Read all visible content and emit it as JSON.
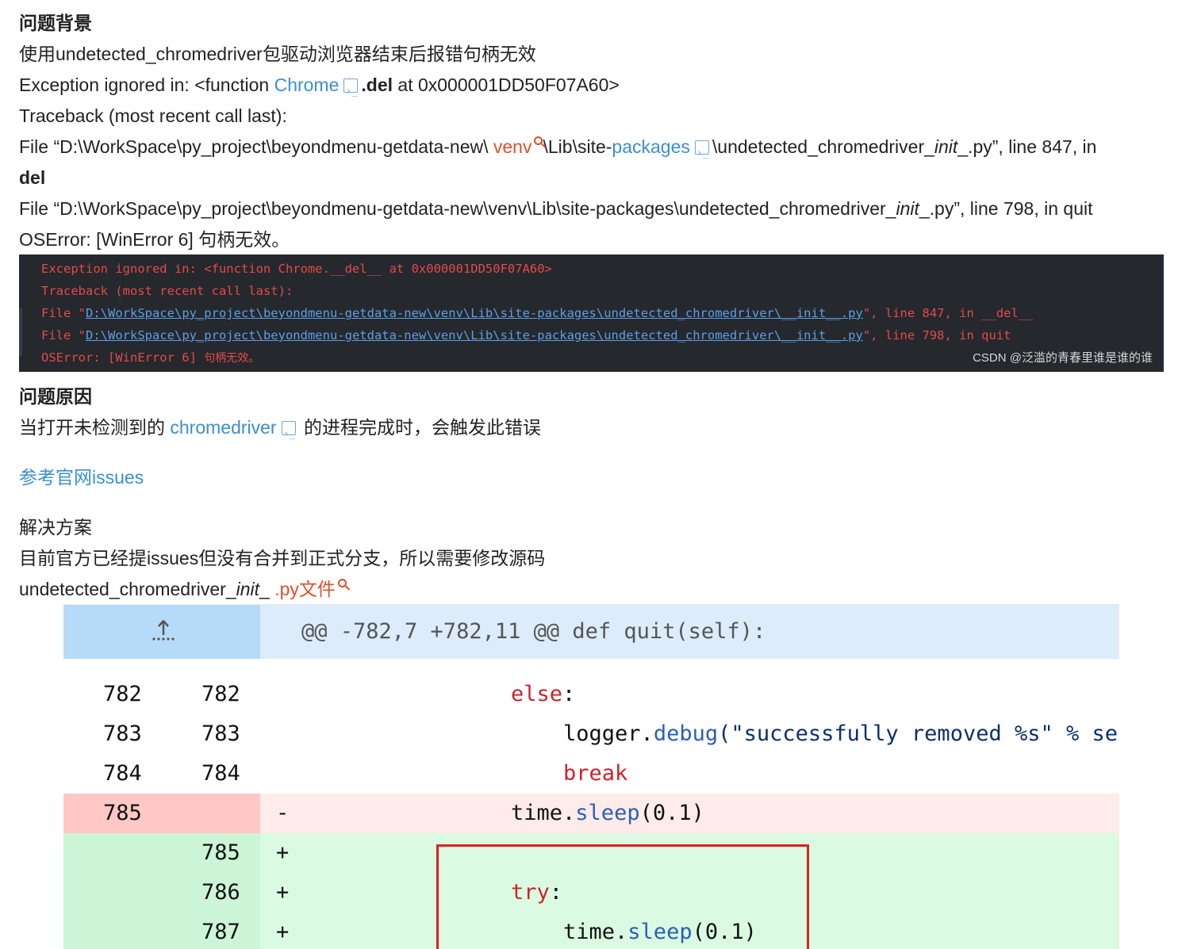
{
  "article": {
    "heading_background": "问题背景",
    "intro": "使用undetected_chromedriver包驱动浏览器结束后报错句柄无效",
    "exc_prefix": "Exception ignored in: <function ",
    "exc_link": "Chrome",
    "exc_del": ".del",
    "exc_suffix": " at 0x000001DD50F07A60>",
    "traceback": "Traceback (most recent call last):",
    "file1_prefix": "File “D:\\WorkSpace\\py_project\\beyondmenu-getdata-new\\ ",
    "file1_venv": "venv",
    "file1_mid": "\\Lib\\site-",
    "file1_packages": "packages",
    "file1_after": "\\undetected_chromedriver_",
    "file1_init": "init",
    "file1_suffix": "_.py”, line 847, in",
    "file1_del": "del",
    "file2_prefix": "File “D:\\WorkSpace\\py_project\\beyondmenu-getdata-new\\venv\\Lib\\site-packages\\undetected_chromedriver_",
    "file2_init": "init",
    "file2_suffix": "_.py”, line 798, in quit",
    "oserror": "OSError: [WinError 6] 句柄无效。",
    "heading_cause": "问题原因",
    "cause_prefix": "当打开未检测到的 ",
    "cause_link": "chromedriver",
    "cause_suffix": " 的进程完成时，会触发此错误",
    "issues_link": "参考官网issues",
    "solution_title": "解决方案",
    "solution_text": "目前官方已经提issues但没有合并到正式分支，所以需要修改源码",
    "file_prefix": "undetected_chromedriver_",
    "file_init": "init",
    "file_sep": "_ ",
    "file_link": ".py文件"
  },
  "terminal": {
    "line1": "Exception ignored in: <function Chrome.__del__ at 0x000001DD50F07A60>",
    "line2": "Traceback (most recent call last):",
    "file_prefix": "  File \"",
    "path": "D:\\WorkSpace\\py_project\\beyondmenu-getdata-new\\venv\\Lib\\site-packages\\undetected_chromedriver\\__init__.py",
    "line3_suffix": "\", line 847, in __del__",
    "line4_suffix": "\", line 798, in quit",
    "line5_prefix": "OSError: [WinError 6] ",
    "line5_cn": "句柄无效。",
    "watermark": "CSDN @泛滥的青春里谁是谁的谁",
    "colors": {
      "background": "#25282d",
      "error_text": "#e34a4a",
      "link": "#5b9fe6"
    }
  },
  "diff": {
    "hunk_header": "@@ -782,7 +782,11 @@ def quit(self):",
    "rows": [
      {
        "type": "context",
        "old": "782",
        "new": "782",
        "sign": ""
      },
      {
        "type": "context",
        "old": "783",
        "new": "783",
        "sign": ""
      },
      {
        "type": "context",
        "old": "784",
        "new": "784",
        "sign": ""
      },
      {
        "type": "removed",
        "old": "785",
        "new": "",
        "sign": "-"
      },
      {
        "type": "added",
        "old": "",
        "new": "785",
        "sign": "+"
      },
      {
        "type": "added",
        "old": "",
        "new": "786",
        "sign": "+"
      },
      {
        "type": "added",
        "old": "",
        "new": "787",
        "sign": "+"
      }
    ],
    "code": {
      "else_kw": "else",
      "colon": ":",
      "logger": "logger",
      "dot": ".",
      "debug_fn": "debug",
      "debug_args": "(\"successfully removed %s\" % se",
      "break_kw": "break",
      "time": "time",
      "sleep_fn": "sleep",
      "sleep_args": "(0.1)",
      "try_kw": "try"
    },
    "colors": {
      "hunk_bg": "#dcecfb",
      "removed_bg": "#ffebe9",
      "removed_gutter": "#ffc8c4",
      "added_bg": "#dafbe1",
      "added_gutter": "#ccf5d7",
      "highlight_box": "#e02020"
    }
  }
}
